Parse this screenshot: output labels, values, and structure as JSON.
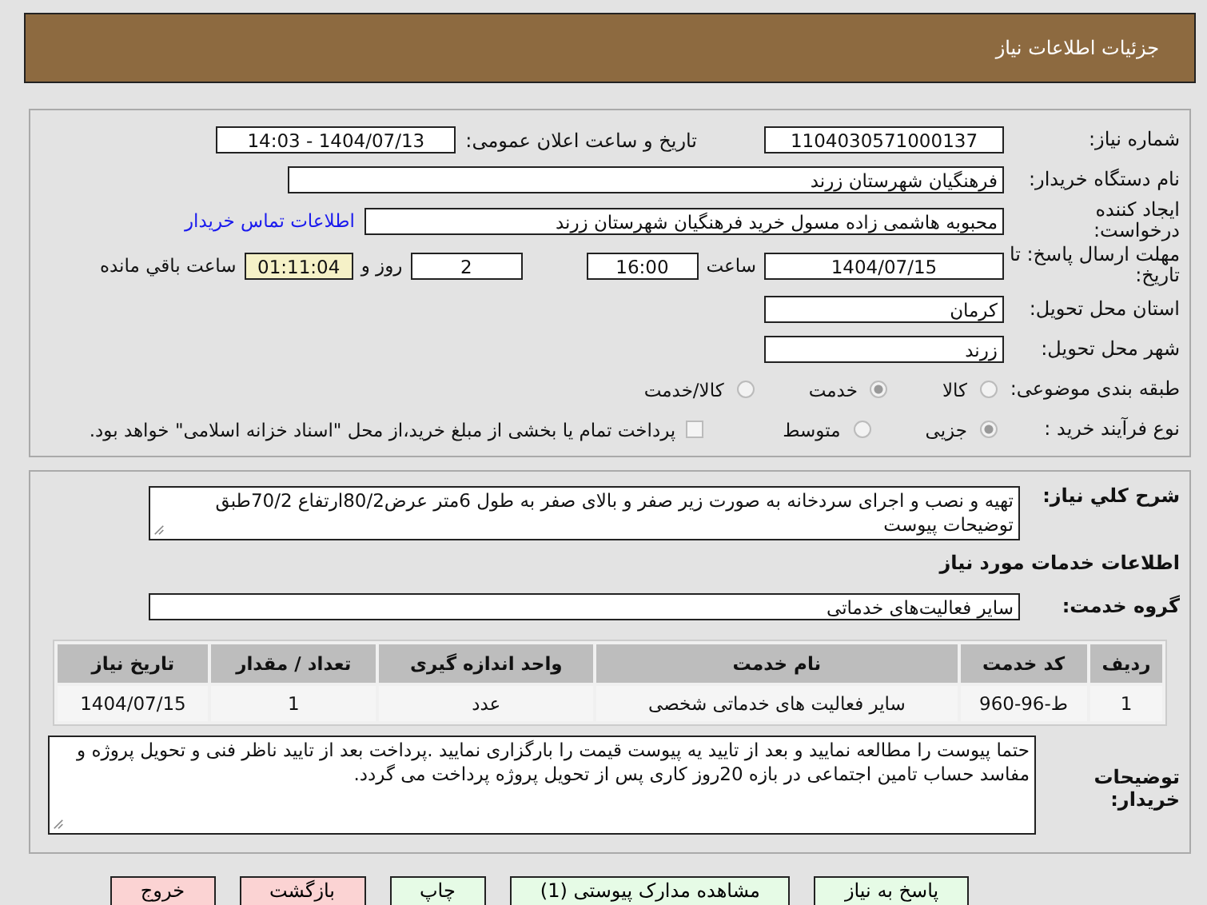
{
  "header": {
    "title": "جزئیات اطلاعات نیاز"
  },
  "need_number": {
    "label": "شماره نیاز:",
    "value": "1104030571000137"
  },
  "announce": {
    "label": "تاریخ و ساعت اعلان عمومی:",
    "value": "1404/07/13 - 14:03"
  },
  "buyer_org": {
    "label": "نام دستگاه خریدار:",
    "value": "فرهنگیان شهرستان زرند"
  },
  "requester": {
    "label": "ایجاد کننده درخواست:",
    "value": "محبوبه هاشمی زاده مسول خرید فرهنگیان شهرستان زرند",
    "link": "اطلاعات تماس خریدار"
  },
  "deadline": {
    "label": "مهلت ارسال پاسخ: تا تاریخ:",
    "date": "1404/07/15",
    "time_label": "ساعت",
    "time": "16:00",
    "days": "2",
    "days_label": "روز و",
    "remaining": "01:11:04",
    "remaining_label": "ساعت باقي مانده"
  },
  "province": {
    "label": "استان محل تحویل:",
    "value": "کرمان"
  },
  "city": {
    "label": "شهر محل تحویل:",
    "value": "زرند"
  },
  "category": {
    "label": "طبقه بندی موضوعی:",
    "options": [
      {
        "label": "کالا",
        "selected": false
      },
      {
        "label": "خدمت",
        "selected": true
      },
      {
        "label": "کالا/خدمت",
        "selected": false
      }
    ]
  },
  "process": {
    "label": "نوع فرآیند خرید :",
    "options": [
      {
        "label": "جزیی",
        "selected": true
      },
      {
        "label": "متوسط",
        "selected": false
      }
    ],
    "treasury": {
      "checked": false,
      "label": "پرداخت تمام یا بخشی از مبلغ خرید،از محل \"اسناد خزانه اسلامی\" خواهد بود."
    }
  },
  "description": {
    "label": "شرح کلي نیاز:",
    "value": "تهیه و نصب و اجرای سردخانه به صورت زیر صفر و بالای صفر به طول 6متر عرض80/2ارتفاع 70/2طبق توضیحات پیوست"
  },
  "services_heading": "اطلاعات خدمات مورد نیاز",
  "service_group": {
    "label": "گروه خدمت:",
    "value": "سایر فعالیت‌های خدماتی"
  },
  "table": {
    "columns": [
      "ردیف",
      "کد خدمت",
      "نام خدمت",
      "واحد اندازه گیری",
      "تعداد / مقدار",
      "تاریخ نیاز"
    ],
    "rows": [
      [
        "1",
        "ط-96-960",
        "سایر فعالیت های خدماتی شخصی",
        "عدد",
        "1",
        "1404/07/15"
      ]
    ]
  },
  "buyer_notes": {
    "label": "توضیحات خریدار:",
    "value": "حتما پیوست را مطالعه نمایید و بعد از تایید یه پیوست قیمت را بارگزاری نمایید .پرداخت بعد از تایید ناظر فنی و تحویل پروژه و مفاسد حساب تامین اجتماعی در بازه 20روز کاری پس از تحویل پروژه  پرداخت می گردد."
  },
  "buttons": [
    {
      "label": "پاسخ به نیاز",
      "color": "#e6fbe6"
    },
    {
      "label": "مشاهده مدارک پیوستی (1)",
      "color": "#e6fbe6"
    },
    {
      "label": "چاپ",
      "color": "#e6fbe6"
    },
    {
      "label": "بازگشت",
      "color": "#fbd3d3"
    },
    {
      "label": "خروج",
      "color": "#fbd3d3"
    }
  ]
}
